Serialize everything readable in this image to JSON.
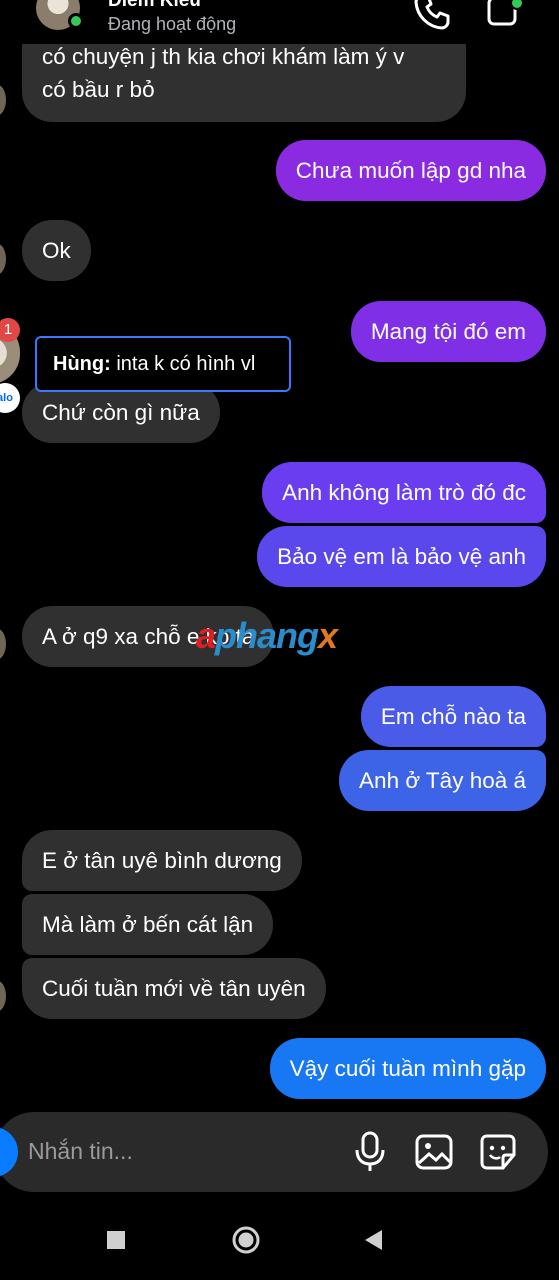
{
  "header": {
    "contact_name": "Diem Kieu",
    "status": "Đang hoạt động",
    "online": true
  },
  "icons": {
    "call": "phone-icon",
    "video": "video-camera-icon",
    "mic": "mic-icon",
    "image": "image-icon",
    "sticker": "sticker-icon"
  },
  "messages": [
    {
      "side": "in",
      "text": "có chuyện j th kia chơi khám làm ý v",
      "text2": "có bầu r bỏ"
    },
    {
      "side": "out",
      "text": "Chưa muốn lập gd nha"
    },
    {
      "side": "in",
      "text": "Ok"
    },
    {
      "side": "out",
      "text": "Mang tội đó em"
    },
    {
      "side": "in",
      "text": "Chứ còn gì nữa"
    },
    {
      "side": "out",
      "text": "Anh không làm trò đó đc"
    },
    {
      "side": "out",
      "text": "Bảo vệ em là bảo vệ anh"
    },
    {
      "side": "in",
      "text": "A ở q9 xa chỗ e ko ta"
    },
    {
      "side": "out",
      "text": "Em chỗ nào ta"
    },
    {
      "side": "out",
      "text": "Anh ở Tây hoà á"
    },
    {
      "side": "in",
      "text": "E ở tân uyê bình dương"
    },
    {
      "side": "in",
      "text": "Mà làm ở bến cát lận"
    },
    {
      "side": "in",
      "text": "Cuối tuần mới về tân uyên"
    },
    {
      "side": "out",
      "text": "Vậy cuối tuần mình gặp"
    }
  ],
  "notification": {
    "badge_count": "1",
    "sender": "Hùng:",
    "preview": " inta k có hình vl",
    "app_chip": "alo"
  },
  "watermark": {
    "a": "a",
    "mid": "phang",
    "x": "x"
  },
  "composer": {
    "placeholder": "Nhắn tin..."
  },
  "colors": {
    "incoming_bubble": "#303030",
    "outgoing_purple": "#8a2be2",
    "outgoing_violet": "#6a3df0",
    "outgoing_indigo": "#4a5be8",
    "outgoing_blue": "#1877f2",
    "online_green": "#35c759"
  }
}
